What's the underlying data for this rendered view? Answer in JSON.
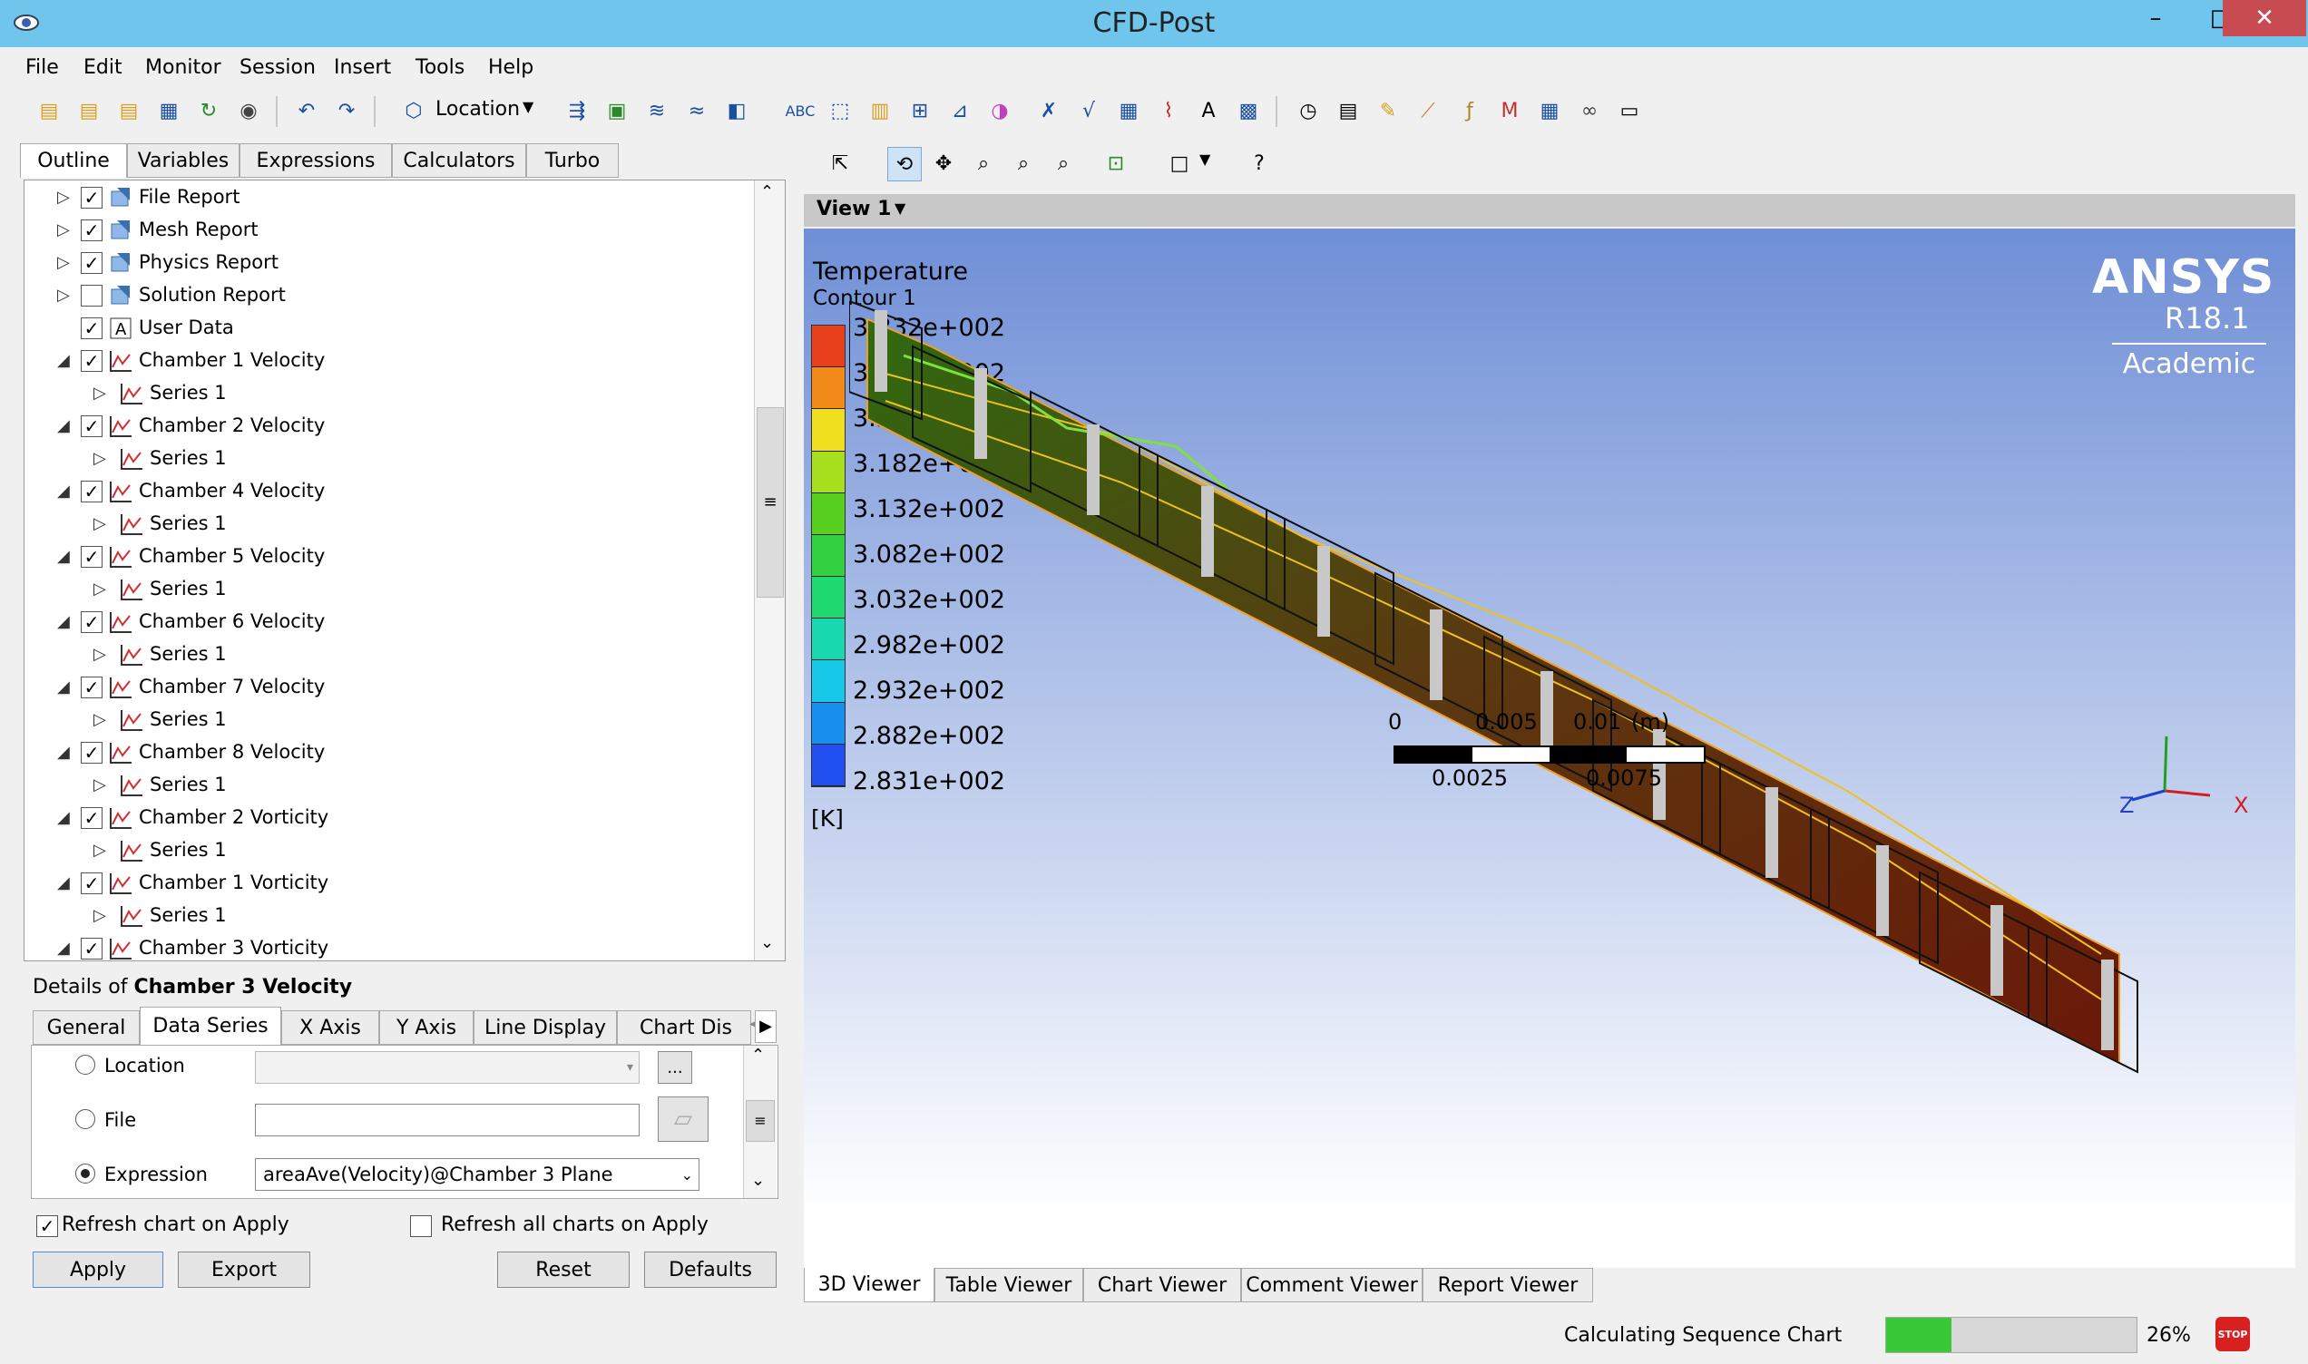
{
  "window": {
    "title": "CFD-Post",
    "minimize": "–",
    "maximize": "□",
    "close": "✕"
  },
  "menu": [
    "File",
    "Edit",
    "Monitor",
    "Session",
    "Insert",
    "Tools",
    "Help"
  ],
  "toolbar": {
    "location_label": "Location"
  },
  "left_tabs": [
    "Outline",
    "Variables",
    "Expressions",
    "Calculators",
    "Turbo"
  ],
  "tree": [
    {
      "label": "File Report",
      "checked": true,
      "level": 0,
      "expander": "▷",
      "icon": "report-icon"
    },
    {
      "label": "Mesh Report",
      "checked": true,
      "level": 0,
      "expander": "▷",
      "icon": "report-icon"
    },
    {
      "label": "Physics Report",
      "checked": true,
      "level": 0,
      "expander": "▷",
      "icon": "report-icon"
    },
    {
      "label": "Solution Report",
      "checked": false,
      "level": 0,
      "expander": "▷",
      "icon": "report-icon"
    },
    {
      "label": "User Data",
      "checked": true,
      "level": 0,
      "expander": "",
      "icon": "text-icon"
    },
    {
      "label": "Chamber 1 Velocity",
      "checked": true,
      "level": 0,
      "expander": "◢",
      "icon": "chart-icon"
    },
    {
      "label": "Series 1",
      "checked": null,
      "level": 1,
      "expander": "▷",
      "icon": "chart-icon"
    },
    {
      "label": "Chamber 2 Velocity",
      "checked": true,
      "level": 0,
      "expander": "◢",
      "icon": "chart-icon"
    },
    {
      "label": "Series 1",
      "checked": null,
      "level": 1,
      "expander": "▷",
      "icon": "chart-icon"
    },
    {
      "label": "Chamber 4 Velocity",
      "checked": true,
      "level": 0,
      "expander": "◢",
      "icon": "chart-icon"
    },
    {
      "label": "Series 1",
      "checked": null,
      "level": 1,
      "expander": "▷",
      "icon": "chart-icon"
    },
    {
      "label": "Chamber 5 Velocity",
      "checked": true,
      "level": 0,
      "expander": "◢",
      "icon": "chart-icon"
    },
    {
      "label": "Series 1",
      "checked": null,
      "level": 1,
      "expander": "▷",
      "icon": "chart-icon"
    },
    {
      "label": "Chamber 6 Velocity",
      "checked": true,
      "level": 0,
      "expander": "◢",
      "icon": "chart-icon"
    },
    {
      "label": "Series 1",
      "checked": null,
      "level": 1,
      "expander": "▷",
      "icon": "chart-icon"
    },
    {
      "label": "Chamber 7 Velocity",
      "checked": true,
      "level": 0,
      "expander": "◢",
      "icon": "chart-icon"
    },
    {
      "label": "Series 1",
      "checked": null,
      "level": 1,
      "expander": "▷",
      "icon": "chart-icon"
    },
    {
      "label": "Chamber 8 Velocity",
      "checked": true,
      "level": 0,
      "expander": "◢",
      "icon": "chart-icon"
    },
    {
      "label": "Series 1",
      "checked": null,
      "level": 1,
      "expander": "▷",
      "icon": "chart-icon"
    },
    {
      "label": "Chamber 2 Vorticity",
      "checked": true,
      "level": 0,
      "expander": "◢",
      "icon": "chart-icon"
    },
    {
      "label": "Series 1",
      "checked": null,
      "level": 1,
      "expander": "▷",
      "icon": "chart-icon"
    },
    {
      "label": "Chamber 1 Vorticity",
      "checked": true,
      "level": 0,
      "expander": "◢",
      "icon": "chart-icon"
    },
    {
      "label": "Series 1",
      "checked": null,
      "level": 1,
      "expander": "▷",
      "icon": "chart-icon"
    },
    {
      "label": "Chamber 3 Vorticity",
      "checked": true,
      "level": 0,
      "expander": "◢",
      "icon": "chart-icon"
    }
  ],
  "details": {
    "prefix": "Details of ",
    "object": "Chamber 3 Velocity",
    "tabs": [
      "General",
      "Data Series",
      "X Axis",
      "Y Axis",
      "Line Display",
      "Chart Dis"
    ],
    "location_label": "Location",
    "location_more": "...",
    "file_label": "File",
    "expression_label": "Expression",
    "expression_value": "areaAve(Velocity)@Chamber 3 Plane",
    "refresh_chart": "Refresh chart on Apply",
    "refresh_all": "Refresh all charts on Apply",
    "buttons": {
      "apply": "Apply",
      "export": "Export",
      "reset": "Reset",
      "defaults": "Defaults"
    }
  },
  "viewer": {
    "view_name": "View 1",
    "legend_title": "Temperature",
    "legend_subtitle": "Contour 1",
    "legend_values": [
      "3.332e+002",
      "3.282e+002",
      "3.232e+002",
      "3.182e+002",
      "3.132e+002",
      "3.082e+002",
      "3.032e+002",
      "2.982e+002",
      "2.932e+002",
      "2.882e+002",
      "2.831e+002"
    ],
    "legend_colors": [
      "#e8401c",
      "#f28a1a",
      "#f0e020",
      "#a8e020",
      "#58d020",
      "#30d040",
      "#20d870",
      "#18d8b0",
      "#18c8e8",
      "#1890f0",
      "#2050f0"
    ],
    "legend_unit": "[K]",
    "brand": "ANSYS",
    "version": "R18.1",
    "edition": "Academic",
    "scale_top": [
      "0",
      "0.005",
      "0.01",
      "(m)"
    ],
    "scale_bottom": [
      "0.0025",
      "0.0075"
    ],
    "axis_labels": [
      "Z",
      "X"
    ],
    "tabs": [
      "3D Viewer",
      "Table Viewer",
      "Chart Viewer",
      "Comment Viewer",
      "Report Viewer"
    ]
  },
  "status": {
    "text": "Calculating Sequence Chart",
    "progress_percent": 26,
    "progress_label": "26%",
    "stop_label": "STOP"
  }
}
